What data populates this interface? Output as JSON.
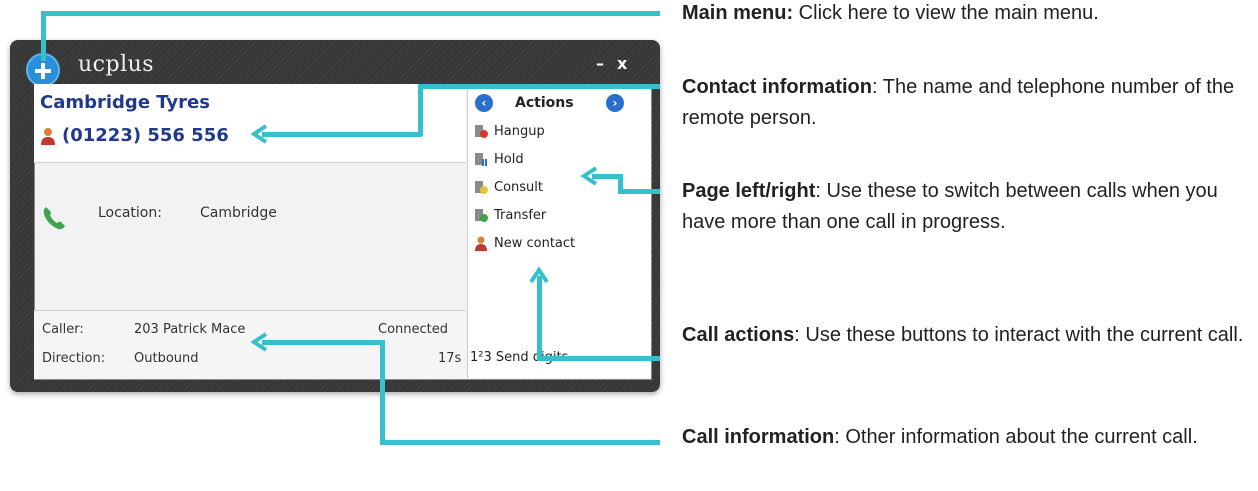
{
  "app": {
    "title": "ucplus",
    "minimize": "–",
    "close": "x"
  },
  "contact": {
    "name": "Cambridge Tyres",
    "phone": "(01223) 556 556"
  },
  "details": {
    "location_label": "Location:",
    "location_value": "Cambridge"
  },
  "call_info": {
    "caller_label": "Caller:",
    "caller_value": "203  Patrick Mace",
    "status": "Connected",
    "direction_label": "Direction:",
    "direction_value": "Outbound",
    "duration": "17s"
  },
  "actions": {
    "title": "Actions",
    "items": [
      {
        "label": "Hangup",
        "icon": "hangup-icon"
      },
      {
        "label": "Hold",
        "icon": "hold-icon"
      },
      {
        "label": "Consult",
        "icon": "consult-icon"
      },
      {
        "label": "Transfer",
        "icon": "transfer-icon"
      },
      {
        "label": "New contact",
        "icon": "new-contact-icon"
      }
    ],
    "send_digits": "Send digits",
    "send_digits_icon": "1²3"
  },
  "annotations": [
    {
      "title": "Main menu:",
      "text": " Click here to view the main menu."
    },
    {
      "title": "Contact information",
      "text": ": The name and telephone number of the remote person."
    },
    {
      "title": "Page left/right",
      "text": ": Use these to switch between calls when you have more than one call in progress."
    },
    {
      "title": "Call actions",
      "text": ": Use these buttons to interact with the current call."
    },
    {
      "title": "Call information",
      "text": ": Other information about the current call."
    }
  ],
  "colors": {
    "callout": "#35c0cc",
    "accent_blue": "#1f3a8a"
  }
}
